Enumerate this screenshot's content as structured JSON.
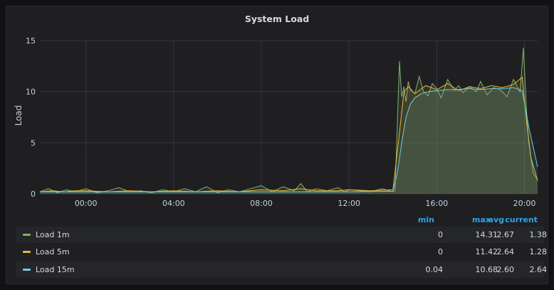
{
  "panel": {
    "title": "System Load"
  },
  "legend": {
    "columns": [
      "min",
      "max",
      "avg",
      "current"
    ],
    "rows": [
      {
        "name": "Load 1m",
        "color": "#7eb26d",
        "min": "0",
        "max": "14.31",
        "avg": "2.67",
        "current": "1.38"
      },
      {
        "name": "Load 5m",
        "color": "#eab839",
        "min": "0",
        "max": "11.42",
        "avg": "2.64",
        "current": "1.28"
      },
      {
        "name": "Load 15m",
        "color": "#6ed0e0",
        "min": "0.04",
        "max": "10.68",
        "avg": "2.60",
        "current": "2.64"
      }
    ]
  },
  "chart_data": {
    "type": "area",
    "title": "System Load",
    "ylabel": "Load",
    "xlabel": "",
    "ylim": [
      0,
      15
    ],
    "yticks": [
      0,
      5,
      10,
      15
    ],
    "x_range_hours": [
      21.9,
      44.6
    ],
    "xticks": [
      {
        "hour": 24,
        "label": "00:00"
      },
      {
        "hour": 28,
        "label": "04:00"
      },
      {
        "hour": 32,
        "label": "08:00"
      },
      {
        "hour": 36,
        "label": "12:00"
      },
      {
        "hour": 40,
        "label": "16:00"
      },
      {
        "hour": 44,
        "label": "20:00"
      }
    ],
    "grid": true,
    "legend_placement": "bottom",
    "series": [
      {
        "name": "Load 1m",
        "color": "#7eb26d",
        "x": [
          21.9,
          22.3,
          22.7,
          23.1,
          23.5,
          24.0,
          24.5,
          25.0,
          25.5,
          26.0,
          26.5,
          27.0,
          27.5,
          28.0,
          28.5,
          29.0,
          29.5,
          30.0,
          30.5,
          31.0,
          31.5,
          32.0,
          32.5,
          33.0,
          33.5,
          33.8,
          34.1,
          34.5,
          35.0,
          35.5,
          35.8,
          36.0,
          36.5,
          37.0,
          37.5,
          38.0,
          38.1,
          38.3,
          38.4,
          38.5,
          38.6,
          38.7,
          38.8,
          39.0,
          39.2,
          39.4,
          39.6,
          39.8,
          40.0,
          40.2,
          40.5,
          40.8,
          41.0,
          41.2,
          41.5,
          41.8,
          42.0,
          42.3,
          42.6,
          42.9,
          43.2,
          43.5,
          43.8,
          43.95,
          44.1,
          44.2,
          44.4,
          44.6
        ],
        "y": [
          0.2,
          0.5,
          0.1,
          0.4,
          0.2,
          0.5,
          0.1,
          0.3,
          0.6,
          0.2,
          0.3,
          0.1,
          0.4,
          0.2,
          0.5,
          0.2,
          0.7,
          0.1,
          0.4,
          0.2,
          0.5,
          0.8,
          0.2,
          0.7,
          0.3,
          1.0,
          0.2,
          0.5,
          0.3,
          0.6,
          0.2,
          0.4,
          0.3,
          0.2,
          0.5,
          0.2,
          0.3,
          13.0,
          9.5,
          10.5,
          9.0,
          11.0,
          10.2,
          9.8,
          11.5,
          10.0,
          9.6,
          10.8,
          10.3,
          9.4,
          11.2,
          10.1,
          10.6,
          9.9,
          10.5,
          10.0,
          11.0,
          9.7,
          10.4,
          10.2,
          9.5,
          11.2,
          10.0,
          14.31,
          8.0,
          5.0,
          2.0,
          1.38
        ]
      },
      {
        "name": "Load 5m",
        "color": "#eab839",
        "x": [
          21.9,
          22.5,
          23.0,
          23.5,
          24.0,
          25.0,
          26.0,
          27.0,
          28.0,
          29.0,
          30.0,
          31.0,
          32.0,
          33.0,
          33.8,
          34.5,
          35.5,
          36.0,
          37.0,
          38.0,
          38.3,
          38.5,
          38.7,
          39.0,
          39.5,
          40.0,
          40.5,
          41.0,
          41.5,
          42.0,
          42.5,
          43.0,
          43.5,
          43.9,
          44.1,
          44.3,
          44.6
        ],
        "y": [
          0.2,
          0.3,
          0.2,
          0.3,
          0.3,
          0.2,
          0.3,
          0.2,
          0.3,
          0.2,
          0.3,
          0.2,
          0.4,
          0.3,
          0.5,
          0.3,
          0.3,
          0.4,
          0.3,
          0.4,
          6.0,
          10.0,
          10.5,
          9.8,
          10.6,
          10.2,
          10.8,
          10.1,
          10.5,
          10.3,
          10.6,
          10.4,
          10.7,
          11.42,
          7.0,
          3.5,
          1.28
        ]
      },
      {
        "name": "Load 15m",
        "color": "#6ed0e0",
        "x": [
          21.9,
          23.0,
          24.0,
          26.0,
          28.0,
          30.0,
          32.0,
          34.0,
          36.0,
          38.0,
          38.2,
          38.4,
          38.6,
          38.8,
          39.0,
          39.3,
          39.6,
          40.0,
          40.5,
          41.0,
          41.5,
          42.0,
          42.5,
          43.0,
          43.5,
          43.9,
          44.2,
          44.6
        ],
        "y": [
          0.2,
          0.2,
          0.2,
          0.2,
          0.2,
          0.2,
          0.2,
          0.2,
          0.2,
          0.25,
          2.0,
          5.0,
          7.5,
          8.8,
          9.4,
          9.8,
          10.0,
          10.1,
          10.2,
          10.2,
          10.3,
          10.2,
          10.3,
          10.3,
          10.4,
          10.1,
          6.5,
          2.64
        ]
      }
    ]
  }
}
